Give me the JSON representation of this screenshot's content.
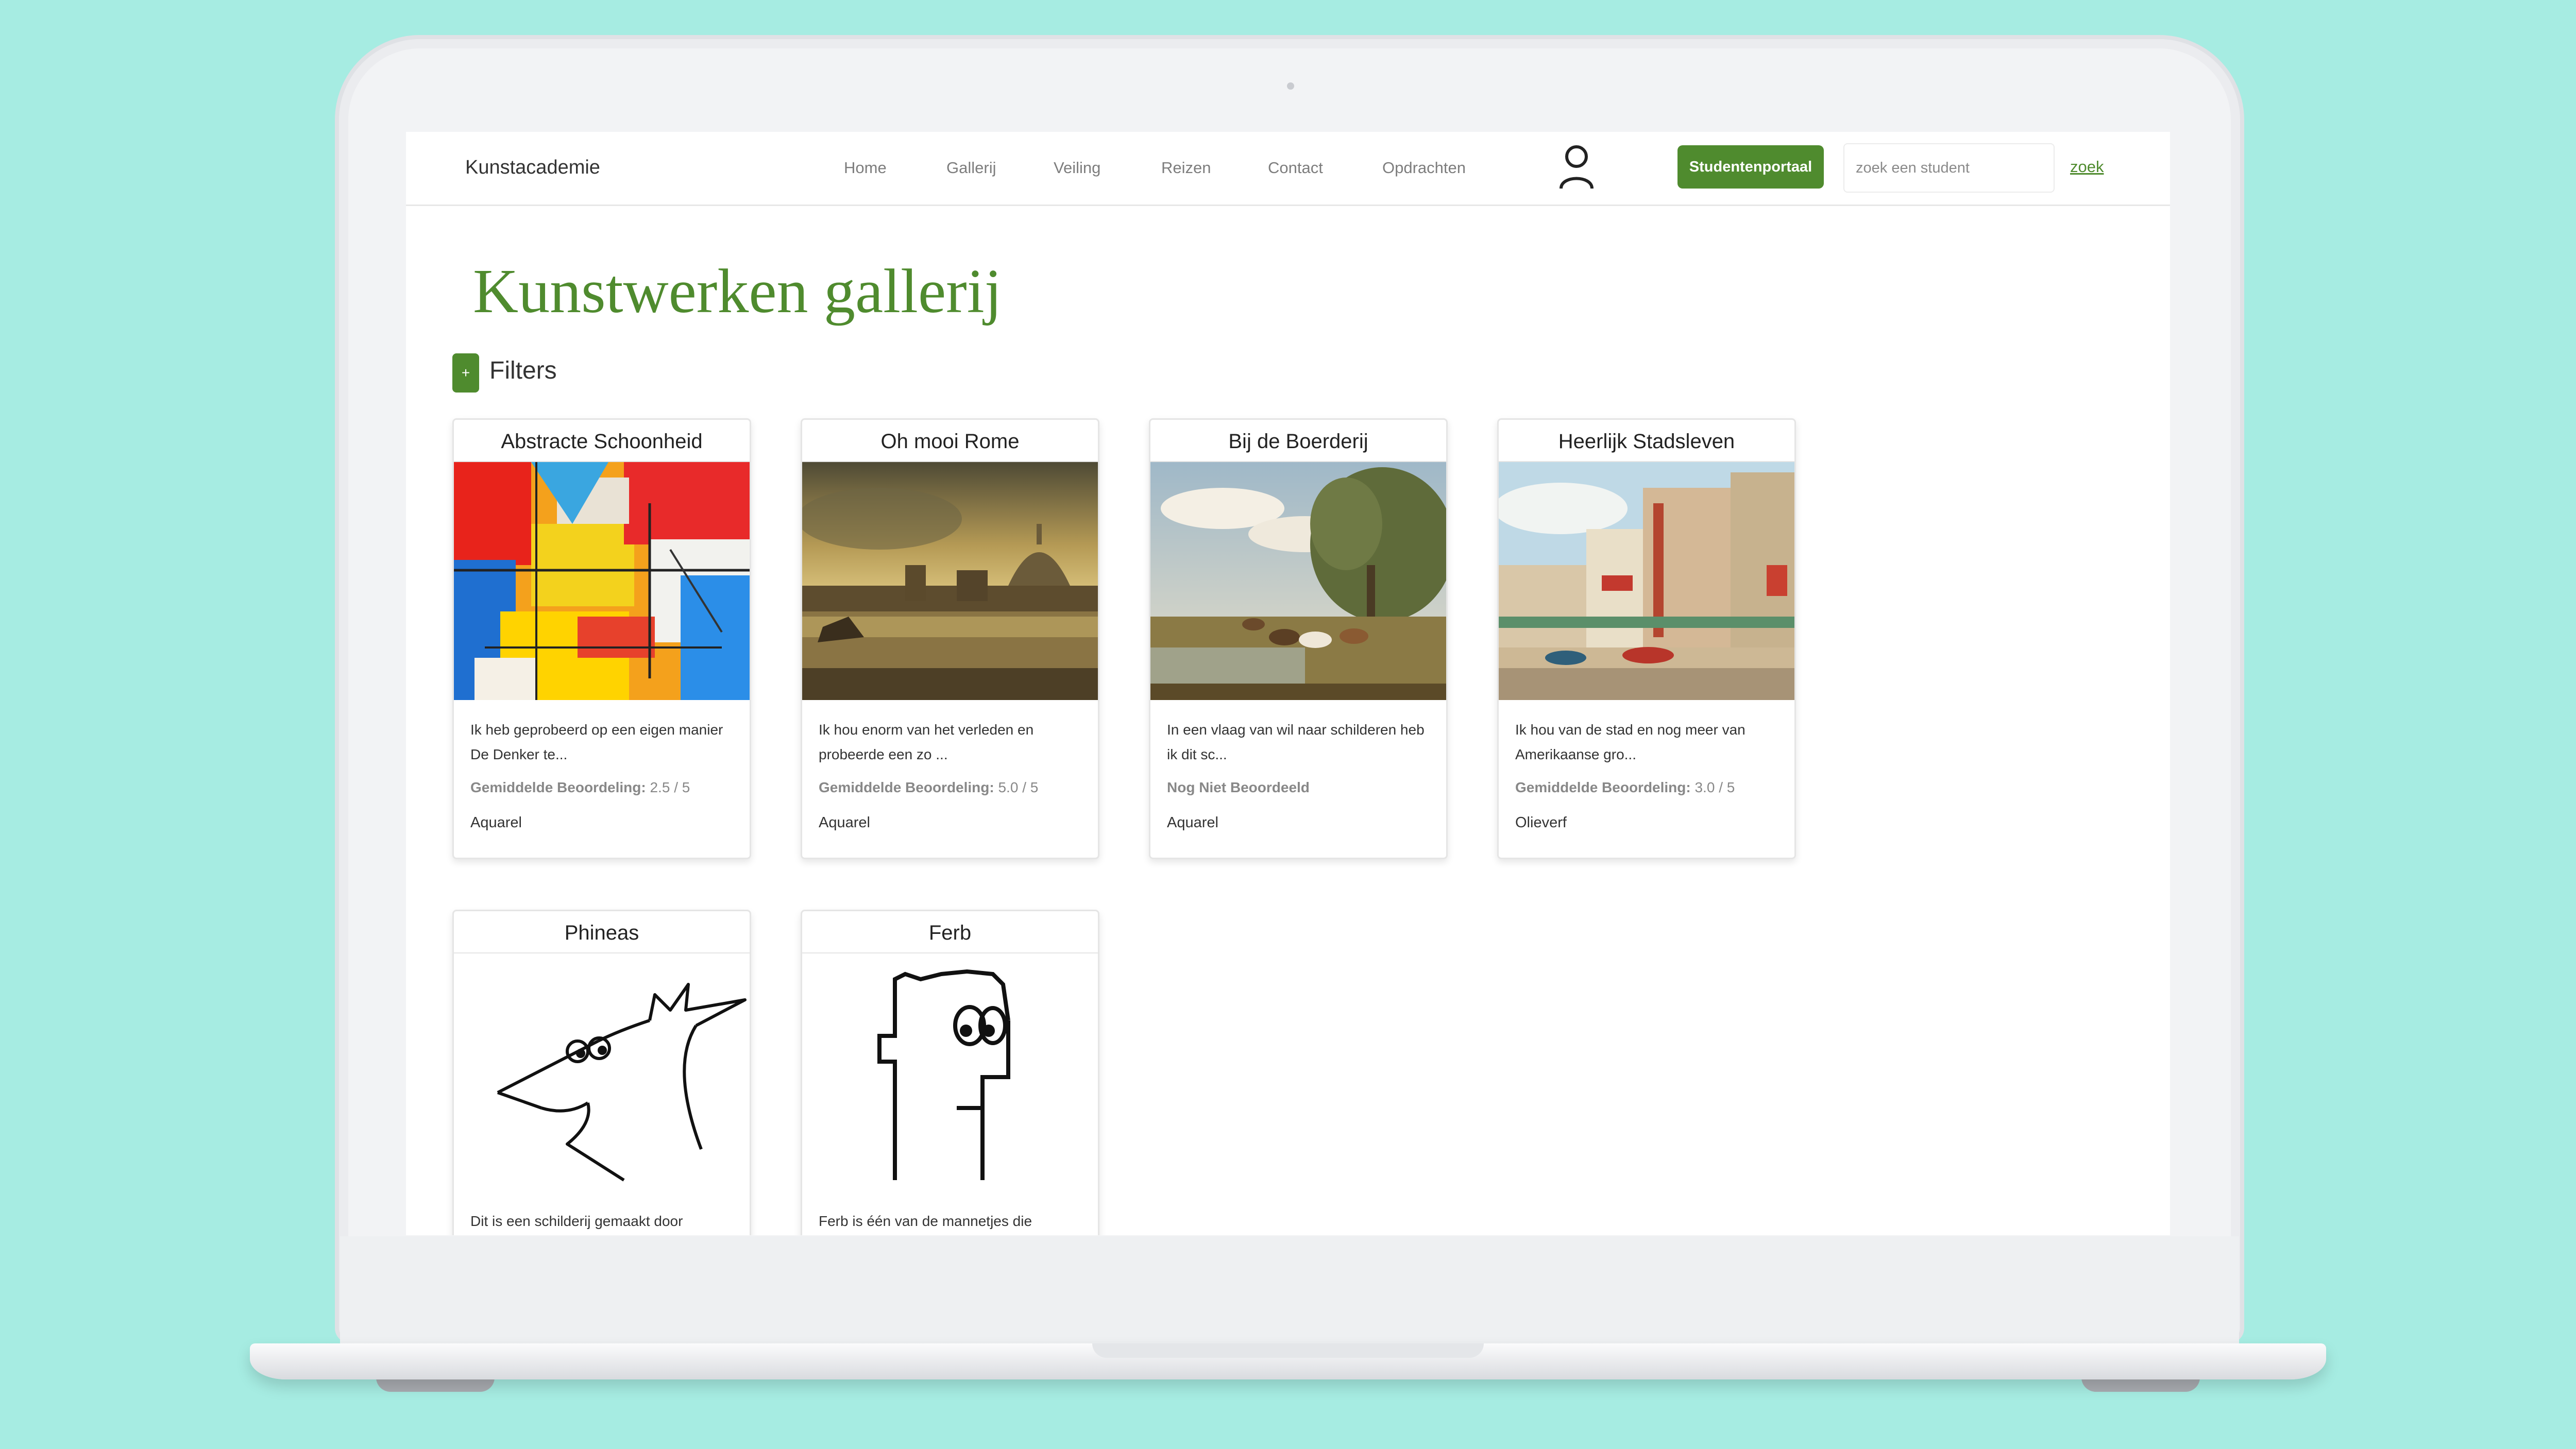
{
  "navbar": {
    "brand": "Kunstacademie",
    "links": [
      "Home",
      "Gallerij",
      "Veiling",
      "Reizen",
      "Contact",
      "Opdrachten"
    ],
    "portal_button": "Studentenportaal",
    "search_placeholder": "zoek een student",
    "search_link": "zoek"
  },
  "page": {
    "title": "Kunstwerken gallerij",
    "filters_toggle": "+",
    "filters_label": "Filters"
  },
  "cards": [
    {
      "title": "Abstracte Schoonheid",
      "description": "Ik heb geprobeerd op een eigen manier De Denker te...",
      "rating_label": "Gemiddelde Beoordeling:",
      "rating_value": "2.5 / 5",
      "type": "Aquarel"
    },
    {
      "title": "Oh mooi Rome",
      "description": "Ik hou enorm van het verleden en probeerde een zo ...",
      "rating_label": "Gemiddelde Beoordeling:",
      "rating_value": "5.0 / 5",
      "type": "Aquarel"
    },
    {
      "title": "Bij de Boerderij",
      "description": "In een vlaag van wil naar schilderen heb ik dit sc...",
      "rating_label": "Nog Niet Beoordeeld",
      "rating_value": "",
      "type": "Aquarel"
    },
    {
      "title": "Heerlijk Stadsleven",
      "description": "Ik hou van de stad en nog meer van Amerikaanse gro...",
      "rating_label": "Gemiddelde Beoordeling:",
      "rating_value": "3.0 / 5",
      "type": "Olieverf"
    },
    {
      "title": "Phineas",
      "description": "Dit is een schilderij gemaakt door"
    },
    {
      "title": "Ferb",
      "description": "Ferb is één van de mannetjes die"
    }
  ],
  "colors": {
    "accent": "#4f8b2e",
    "background": "#a6ece2"
  },
  "icons": {
    "user": "user-icon",
    "plus": "plus-icon"
  }
}
